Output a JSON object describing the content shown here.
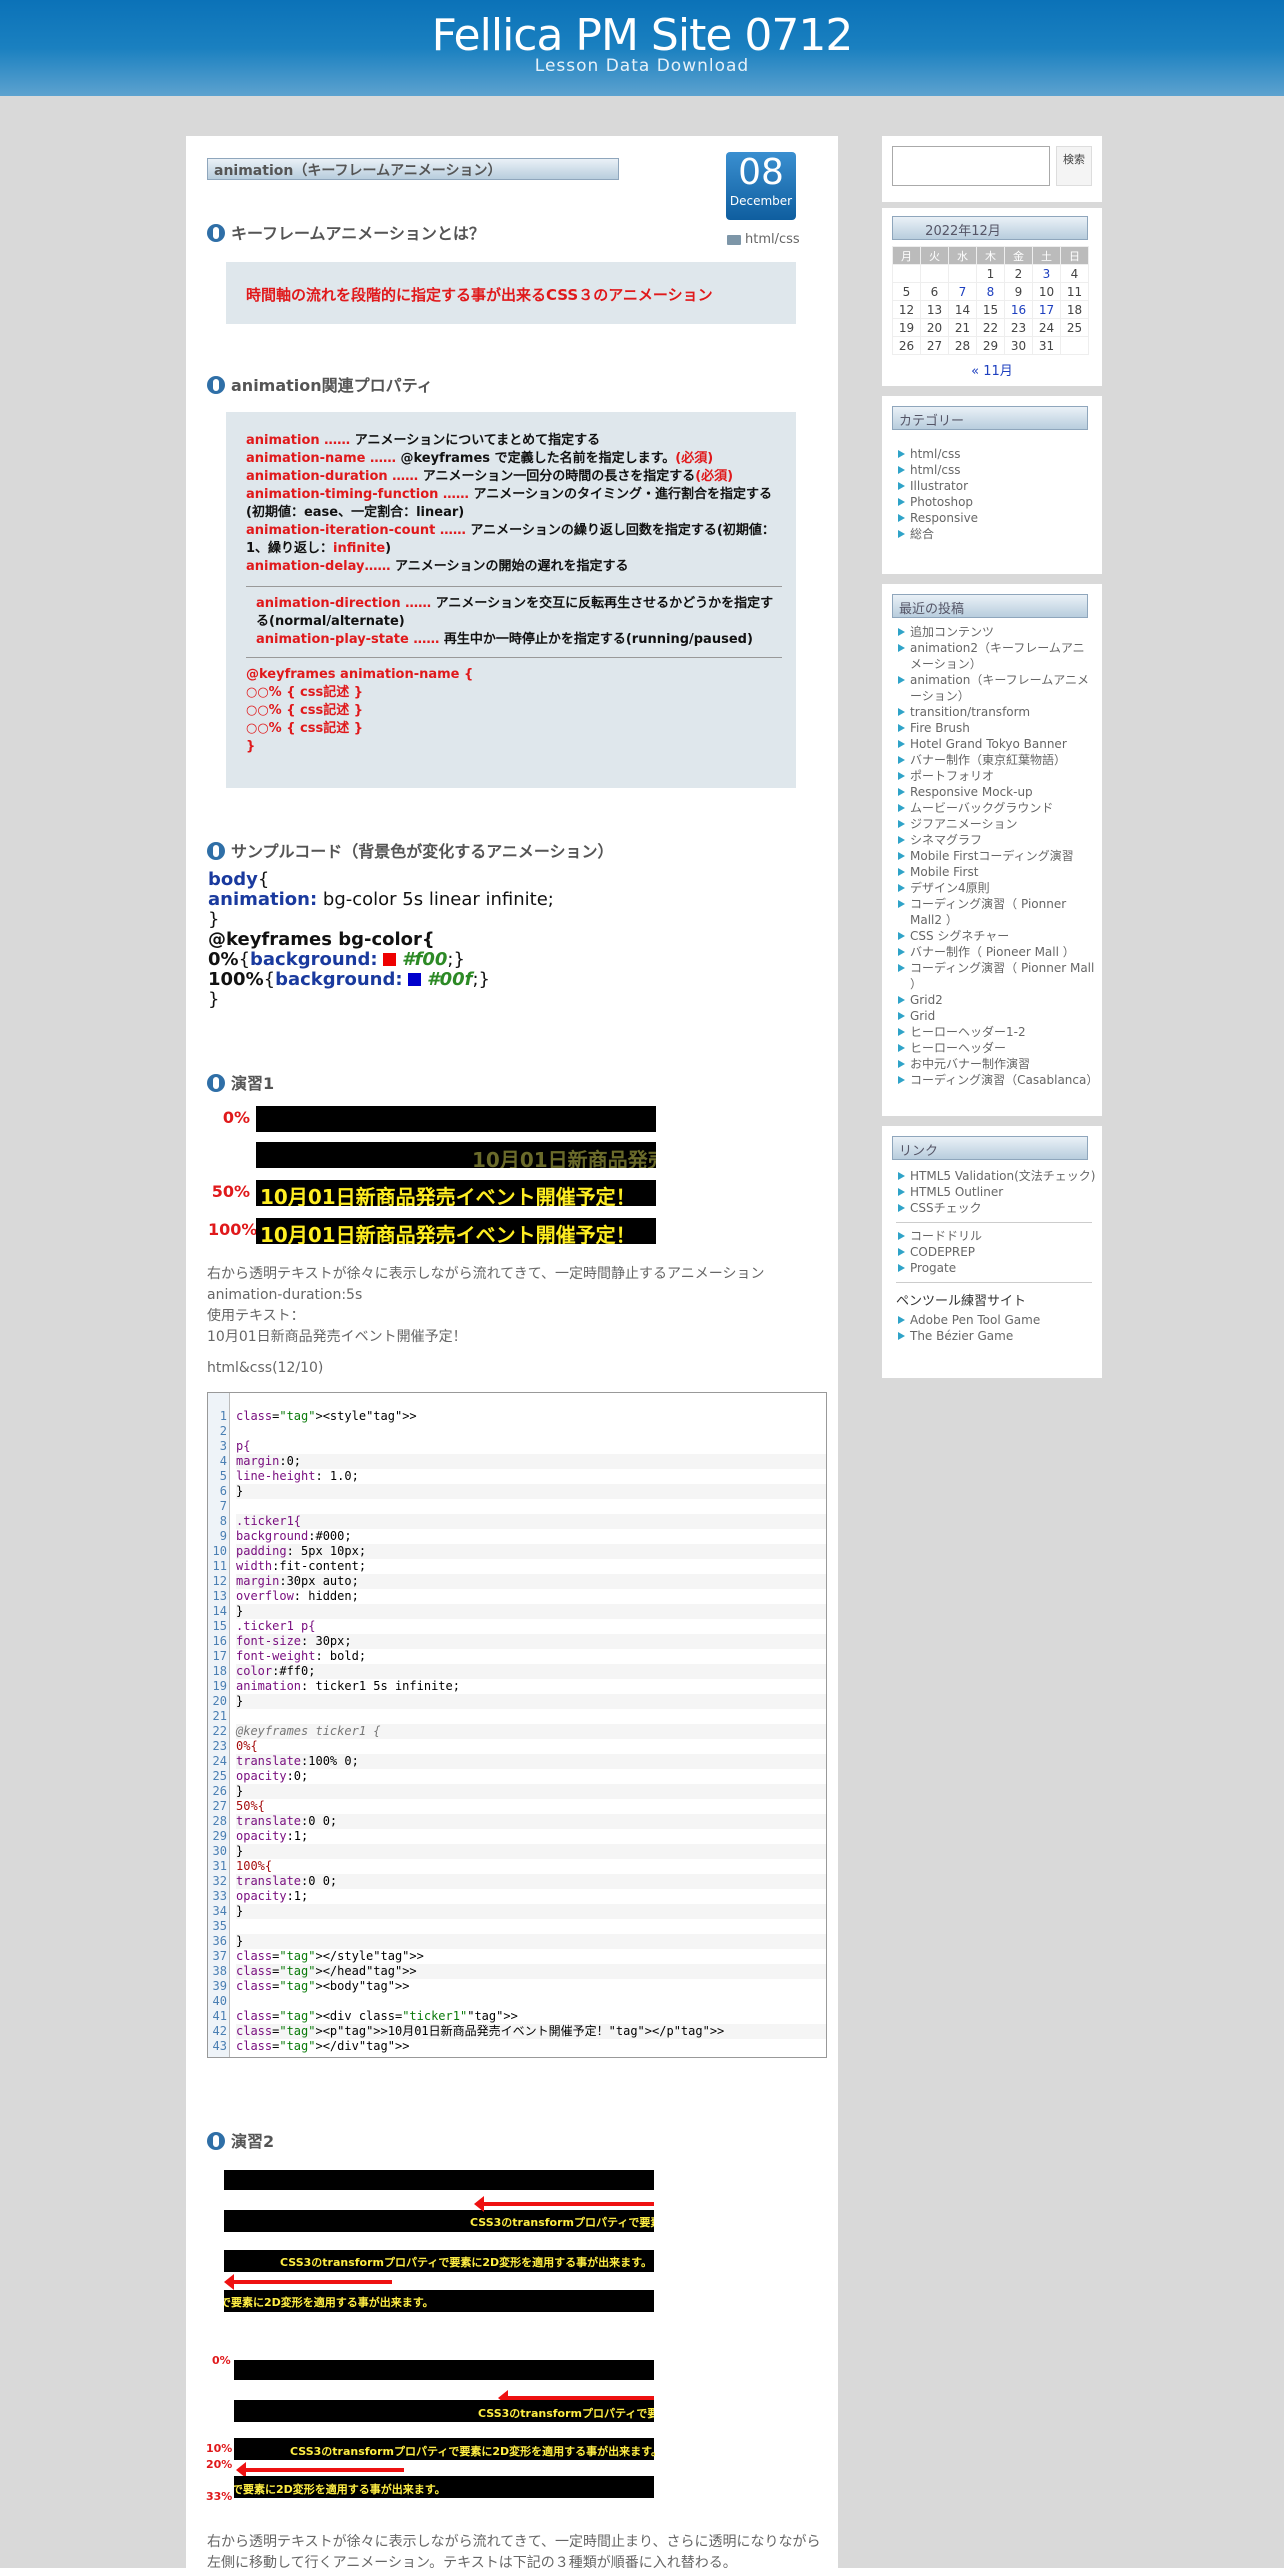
{
  "header": {
    "title": "Fellica PM Site 0712",
    "subtitle": "Lesson Data Download"
  },
  "post": {
    "title": "animation（キーフレームアニメーション）",
    "date_day": "08",
    "date_month": "December",
    "category": "html/css",
    "section1_title": "キーフレームアニメーションとは？",
    "section1_text": "時間軸の流れを段階的に指定する事が出来るCSS３のアニメーション",
    "section2_title": "animation関連プロパティ",
    "props": [
      {
        "name": "animation ……",
        "desc": " アニメーションについてまとめて指定する",
        "req": ""
      },
      {
        "name": "animation-name ……",
        "desc": " @keyframes で定義した名前を指定します。",
        "req": "(必須)"
      },
      {
        "name": "animation-duration ……",
        "desc": " アニメーション一回分の時間の長さを指定する",
        "req": "(必須)"
      },
      {
        "name": "animation-timing-function ……",
        "desc": " アニメーションのタイミング・進行割合を指定する(初期値：ease、一定割合：linear)",
        "req": ""
      },
      {
        "name": "animation-iteration-count ……",
        "desc": " アニメーションの繰り返し回数を指定する(初期値：1、繰り返し：",
        "req": "infinite",
        "after": ")"
      },
      {
        "name": "animation-delay……",
        "desc": " アニメーションの開始の遅れを指定する",
        "req": ""
      }
    ],
    "props2": [
      {
        "name": "animation-direction ……",
        "desc": " アニメーションを交互に反転再生させるかどうかを指定する(normal/alternate)"
      },
      {
        "name": "animation-play-state ……",
        "desc": " 再生中か一時停止かを指定する(running/paused)"
      }
    ],
    "keyframes": [
      "@keyframes animation-name {",
      "○○% { css記述 }",
      "○○% { css記述 }",
      "○○% { css記述 }",
      "}"
    ],
    "section3_title": "サンプルコード（背景色が変化するアニメーション）",
    "sample": {
      "l1a": "body",
      "l1b": "{",
      "l2a": "animation:",
      "l2b": " bg-color 5s linear infinite;",
      "l3": "}",
      "l4": "@keyframes bg-color{",
      "l5a": "0%",
      "l5b": "{",
      "l5c": "background:",
      "l5d": "#f00",
      "l5e": ";}",
      "l6a": "100%",
      "l6b": "{",
      "l6c": "background:",
      "l6d": "#00f",
      "l6e": ";}",
      "l7": "}"
    },
    "ex1_title": "演習1",
    "ex1_labels": [
      "0%",
      "50%",
      "100%"
    ],
    "ex1_ticker": "10月01日新商品発売イベント開催予定！",
    "ex1_desc": [
      "右から透明テキストが徐々に表示しながら流れてきて、一定時間静止するアニメーション",
      "animation-duration:5s",
      "使用テキスト：",
      "10月01日新商品発売イベント開催予定！"
    ],
    "ex1_code_label": "html&css(12/10)",
    "ex2_title": "演習2",
    "ex2_ticker": "CSS3のtransformプロパティで要素に2D変形を適用する事が出来ます。",
    "ex2_short": "CSS3のtransformプロパティで要素に2D",
    "ex2_tail": "で要素に2D変形を適用する事が出来ます。",
    "ex2_labels": [
      "0%",
      "10%",
      "20%",
      "33%"
    ],
    "ex2_desc": [
      "右から透明テキストが徐々に表示しながら流れてきて、一定時間止まり、さらに透明になりながら",
      "左側に移動して行くアニメーション。テキストは下記の３種類が順番に入れ替わる。"
    ]
  },
  "code_lines": [
    "<style>",
    "",
    "p{",
    "margin:0;",
    "line-height: 1.0;",
    "}",
    "",
    ".ticker1{",
    "background:#000;",
    "padding: 5px 10px;",
    "width:fit-content;",
    "margin:30px auto;",
    "overflow: hidden;",
    "}",
    ".ticker1 p{",
    "font-size: 30px;",
    "font-weight: bold;",
    "color:#ff0;",
    "animation: ticker1 5s infinite;",
    "}",
    "",
    "@keyframes ticker1 {",
    "0%{",
    "translate:100% 0;",
    "opacity:0;",
    "}",
    "50%{",
    "translate:0 0;",
    "opacity:1;",
    "}",
    "100%{",
    "translate:0 0;",
    "opacity:1;",
    "}",
    "",
    "}",
    "</style>",
    "</head>",
    "<body>",
    "",
    "<div class=\"ticker1\">",
    "<p>10月01日新商品発売イベント開催予定！</p>",
    "</div>"
  ],
  "sidebar": {
    "search_button": "検索",
    "calendar": {
      "title": "2022年12月",
      "weekdays": [
        "月",
        "火",
        "水",
        "木",
        "金",
        "土",
        "日"
      ],
      "rows": [
        [
          "",
          "",
          "",
          "1",
          "2",
          "3",
          "4"
        ],
        [
          "5",
          "6",
          "7",
          "8",
          "9",
          "10",
          "11"
        ],
        [
          "12",
          "13",
          "14",
          "15",
          "16",
          "17",
          "18"
        ],
        [
          "19",
          "20",
          "21",
          "22",
          "23",
          "24",
          "25"
        ],
        [
          "26",
          "27",
          "28",
          "29",
          "30",
          "31",
          ""
        ]
      ],
      "linked": [
        "3",
        "7",
        "8",
        "16",
        "17"
      ],
      "prev": "« 11月"
    },
    "categories_title": "カテゴリー",
    "categories": [
      "html/css",
      "html/css",
      "Illustrator",
      "Photoshop",
      "Responsive",
      "総合"
    ],
    "recent_title": "最近の投稿",
    "recent": [
      "追加コンテンツ",
      "animation2（キーフレームアニメーション）",
      "animation（キーフレームアニメーション）",
      "transition/transform",
      "Fire Brush",
      "Hotel Grand Tokyo Banner",
      "バナー制作（東京紅葉物語）",
      "ポートフォリオ",
      "Responsive Mock-up",
      "ムービーバックグラウンド",
      "ジフアニメーション",
      "シネマグラフ",
      "Mobile Firstコーディング演習",
      "Mobile First",
      "デザイン4原則",
      "コーディング演習（ Pionner Mall2 ）",
      "CSS シグネチャー",
      "バナー制作（ Pioneer Mall ）",
      "コーディング演習（ Pionner Mall ）",
      "Grid2",
      "Grid",
      "ヒーローヘッダー1-2",
      "ヒーローヘッダー",
      "お中元バナー制作演習",
      "コーディング演習（Casablanca）"
    ],
    "links_title": "リンク",
    "links1": [
      "HTML5 Validation(文法チェック)",
      "HTML5 Outliner",
      "CSSチェック"
    ],
    "links2": [
      "コードドリル",
      "CODEPREP",
      "Progate"
    ],
    "pentool_title": "ペンツール練習サイト",
    "links3": [
      "Adobe Pen Tool Game",
      "The Bézier Game"
    ]
  }
}
